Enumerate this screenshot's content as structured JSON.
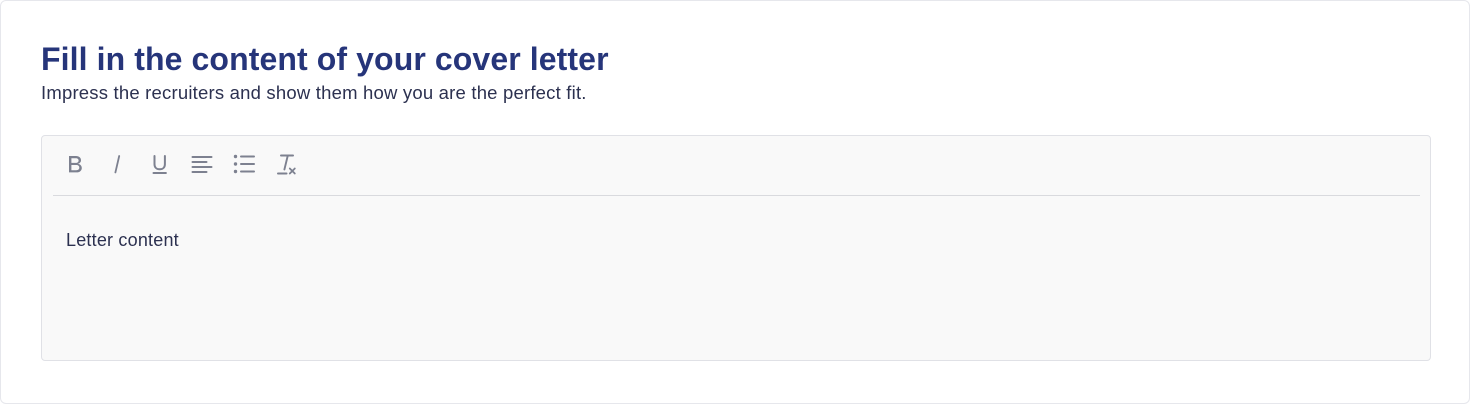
{
  "header": {
    "title": "Fill in the content of your cover letter",
    "subtitle": "Impress the recruiters and show them how you are the perfect fit."
  },
  "editor": {
    "toolbar": [
      {
        "icon": "bold-icon",
        "action": "bold"
      },
      {
        "icon": "italic-icon",
        "action": "italic"
      },
      {
        "icon": "underline-icon",
        "action": "underline"
      },
      {
        "icon": "align-left-icon",
        "action": "align-left"
      },
      {
        "icon": "bullet-list-icon",
        "action": "bullet-list"
      },
      {
        "icon": "clear-formatting-icon",
        "action": "clear-formatting"
      }
    ],
    "content": "Letter content"
  },
  "colors": {
    "title": "#26357a",
    "text": "#2c3150",
    "icon": "#7d8190",
    "editor_background": "#f9f9f9",
    "border": "#e0e1e6"
  }
}
